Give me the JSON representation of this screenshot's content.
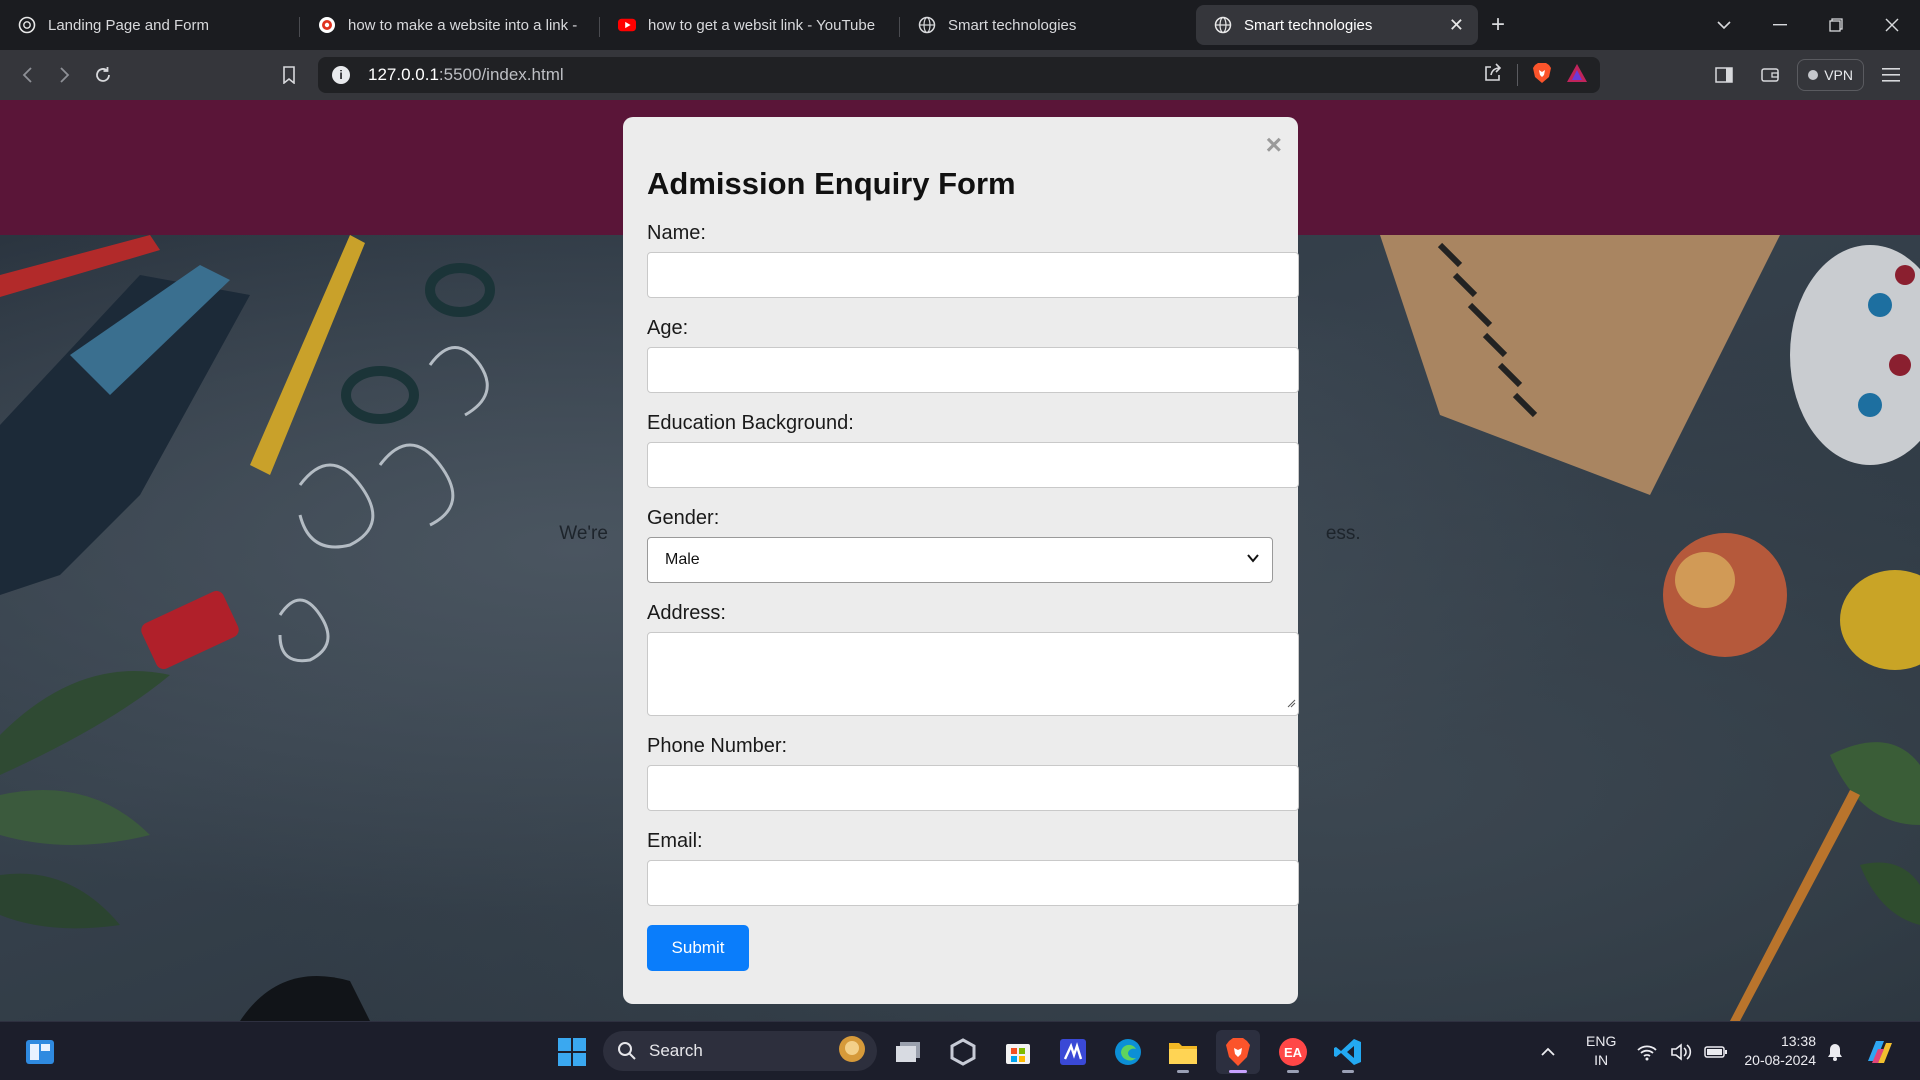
{
  "browser": {
    "tabs": [
      {
        "title": "Landing Page and Form",
        "favicon": "openai-icon"
      },
      {
        "title": "how to make a website into a link -",
        "favicon": "brave-search-icon"
      },
      {
        "title": "how to get a websit link - YouTube",
        "favicon": "youtube-icon"
      },
      {
        "title": "Smart technologies",
        "favicon": "globe-icon"
      },
      {
        "title": "Smart technologies",
        "favicon": "globe-icon",
        "active": true
      }
    ],
    "url_host": "127.0.0.1",
    "url_path": ":5500/index.html",
    "vpn_label": "VPN"
  },
  "page": {
    "header_color": "#5a1538",
    "hero_text": "We're                                                                                                                                        ess."
  },
  "form": {
    "title": "Admission Enquiry Form",
    "close_glyph": "×",
    "name_label": "Name:",
    "age_label": "Age:",
    "education_label": "Education Background:",
    "gender_label": "Gender:",
    "gender_selected": "Male",
    "address_label": "Address:",
    "phone_label": "Phone Number:",
    "email_label": "Email:",
    "submit_label": "Submit",
    "submit_color": "#0a7dfb"
  },
  "taskbar": {
    "search_label": "Search",
    "lang_line1": "ENG",
    "lang_line2": "IN",
    "time": "13:38",
    "date": "20-08-2024"
  }
}
